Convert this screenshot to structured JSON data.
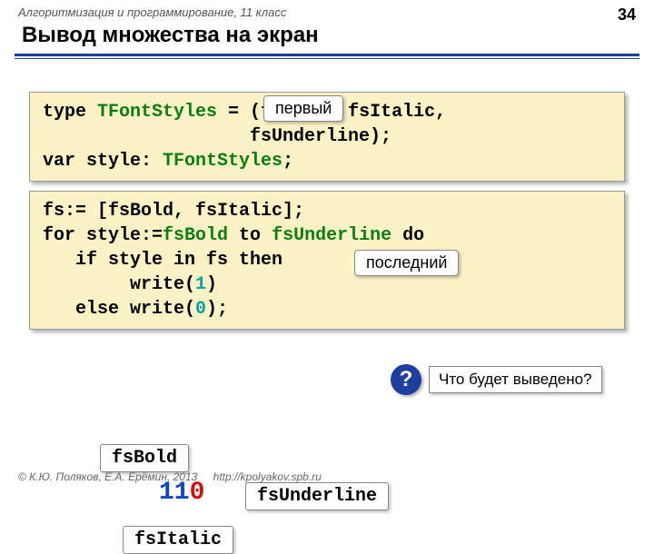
{
  "page_number": "34",
  "header_subject": "Алгоритмизация и программирование, 11 класс",
  "title": "Вывод множества на экран",
  "tags": {
    "first": "первый",
    "last": "последний"
  },
  "code1": {
    "l1a": "type ",
    "l1b": "TFontStyles",
    "l1c": " = (fsBold, fsItalic,",
    "l2": "                   fsUnderline);",
    "l3a": "var style: ",
    "l3b": "TFontStyles",
    "l3c": ";"
  },
  "code2": {
    "l1": "fs:= [fsBold, fsItalic];",
    "l2a": "for style:=",
    "l2b": "fsBold",
    "l2c": " to ",
    "l2d": "fsUnderline",
    "l2e": " do",
    "l3": "   if style in fs then",
    "l4a": "        write(",
    "l4b": "1",
    "l4c": ")",
    "l5a": "   else write(",
    "l5b": "0",
    "l5c": ");"
  },
  "question": {
    "mark": "?",
    "text": "Что будет выведено?"
  },
  "labels": {
    "bold": "fsBold",
    "italic": "fsItalic",
    "underline": "fsUnderline"
  },
  "result": {
    "ones": "11",
    "zero": "0"
  },
  "footer": {
    "authors": "© К.Ю. Поляков, Е.А. Ерёмин, 2013",
    "url": "http://kpolyakov.spb.ru"
  }
}
